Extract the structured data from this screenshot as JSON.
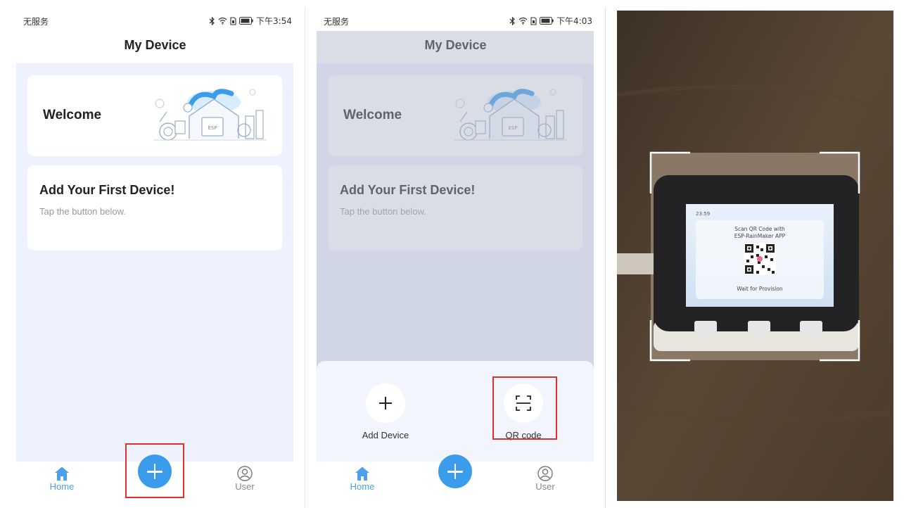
{
  "screens": [
    {
      "status": {
        "carrier": "无服务",
        "time": "下午3:54"
      },
      "title": "My Device",
      "welcome_card": {
        "text": "Welcome"
      },
      "first_card": {
        "title": "Add Your First Device!",
        "subtitle": "Tap the button below."
      },
      "nav": {
        "home": "Home",
        "user": "User"
      }
    },
    {
      "status": {
        "carrier": "无服务",
        "time": "下午4:03"
      },
      "title": "My Device",
      "welcome_card": {
        "text": "Welcome"
      },
      "first_card": {
        "title": "Add Your First Device!",
        "subtitle": "Tap the button below."
      },
      "sheet": {
        "add_device": "Add Device",
        "qr_code": "QR code"
      },
      "nav": {
        "home": "Home",
        "user": "User"
      }
    }
  ],
  "illustration": {
    "chip_label": "ESP"
  },
  "camera_view": {
    "device_screen": {
      "time": "23:59",
      "line1": "Scan QR Code with",
      "line2": "ESP-RainMaker APP",
      "footer": "Wait for Provision"
    }
  },
  "colors": {
    "accent": "#3a9cea",
    "highlight_box": "#e0302a",
    "content_bg": "#eef2fe"
  },
  "icons": [
    "bluetooth-icon",
    "wifi-icon",
    "sim-icon",
    "battery-icon",
    "home-icon",
    "user-icon",
    "plus-icon",
    "qr-scan-icon"
  ]
}
